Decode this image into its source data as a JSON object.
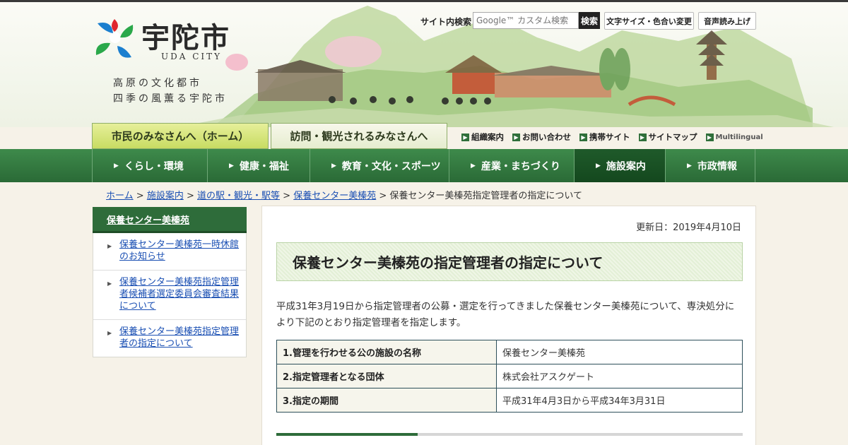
{
  "header": {
    "site_name": "宇陀市",
    "site_name_en": "UDA CITY",
    "tagline_1": "高原の文化都市",
    "tagline_2": "四季の風薫る宇陀市",
    "search_label": "サイト内検索",
    "search_placeholder": "Google™ カスタム検索",
    "search_button": "検索",
    "font_color_button": "文字サイズ・色合い変更",
    "voice_button": "音声読み上げ"
  },
  "tabs": {
    "home": "市民のみなさんへ（ホーム）",
    "visit": "訪問・観光されるみなさんへ"
  },
  "util_links": [
    "組織案内",
    "お問い合わせ",
    "携帯サイト",
    "サイトマップ"
  ],
  "multilingual": "Multilingual",
  "nav": [
    {
      "label": "くらし・環境"
    },
    {
      "label": "健康・福祉"
    },
    {
      "label": "教育・文化・スポーツ"
    },
    {
      "label": "産業・まちづくり"
    },
    {
      "label": "施設案内",
      "active": true
    },
    {
      "label": "市政情報"
    }
  ],
  "breadcrumb": {
    "items": [
      "ホーム",
      "施設案内",
      "道の駅・観光・駅等",
      "保養センター美榛苑"
    ],
    "current": "保養センター美榛苑指定管理者の指定について"
  },
  "sidebar": {
    "title": "保養センター美榛苑",
    "items": [
      "保養センター美榛苑一時休館のお知らせ",
      "保養センター美榛苑指定管理者候補者選定委員会審査結果について",
      "保養センター美榛苑指定管理者の指定について"
    ]
  },
  "main": {
    "updated": "更新日：2019年4月10日",
    "title": "保養センター美榛苑の指定管理者の指定について",
    "lead": "平成31年3月19日から指定管理者の公募・選定を行ってきました保養センター美榛苑について、専決処分により下記のとおり指定管理者を指定します。",
    "table": [
      {
        "key": "1.管理を行わせる公の施設の名称",
        "value": "保養センター美榛苑"
      },
      {
        "key": "2.指定管理者となる団体",
        "value": "株式会社アスクゲート"
      },
      {
        "key": "3.指定の期間",
        "value": "平成31年4月3日から平成34年3月31日"
      }
    ]
  },
  "colors": {
    "nav_green": "#2a6a36",
    "link_blue": "#1a4fb3",
    "sidebar_green": "#2e6c3a"
  }
}
